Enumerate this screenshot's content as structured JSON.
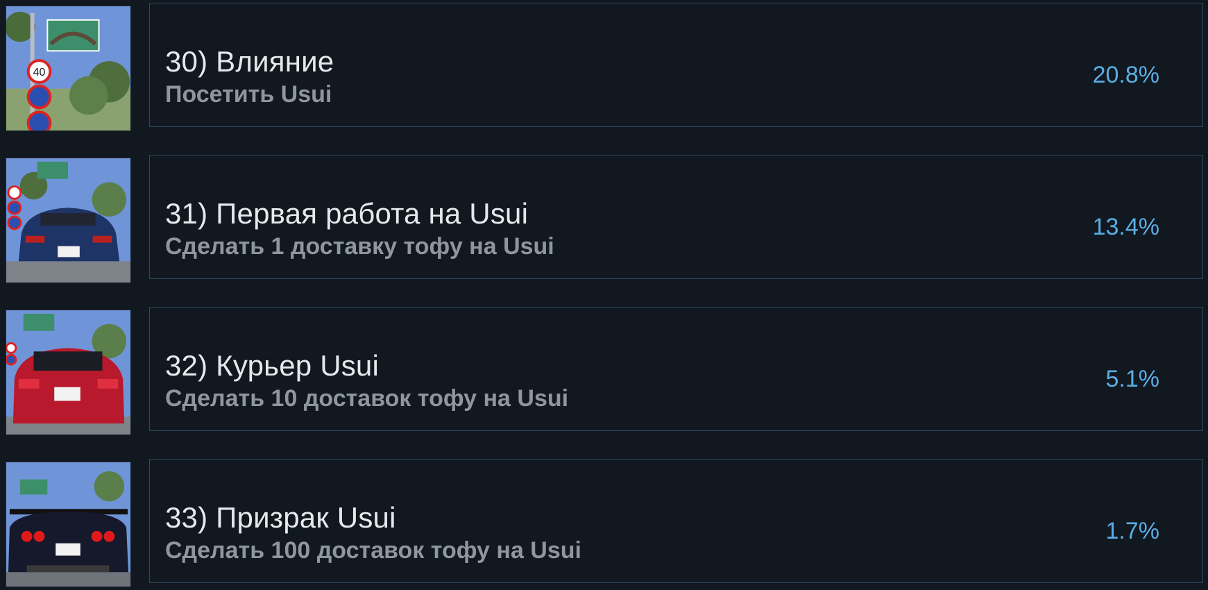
{
  "achievements": [
    {
      "title": "30) Влияние",
      "description": "Посетить Usui",
      "percent": "20.8%",
      "icon": "road-signs-icon"
    },
    {
      "title": "31) Первая работа на Usui",
      "description": "Сделать 1 доставку тофу на Usui",
      "percent": "13.4%",
      "icon": "blue-car-icon"
    },
    {
      "title": "32) Курьер Usui",
      "description": "Сделать 10 доставок тофу на Usui",
      "percent": "5.1%",
      "icon": "red-car-icon"
    },
    {
      "title": "33) Призрак Usui",
      "description": "Сделать 100 доставок тофу на Usui",
      "percent": "1.7%",
      "icon": "dark-car-icon"
    }
  ],
  "colors": {
    "background": "#111820",
    "panel_border": "#2d4a5e",
    "title": "#e6e9ec",
    "description": "#8f969c",
    "percent": "#5aaee6"
  }
}
